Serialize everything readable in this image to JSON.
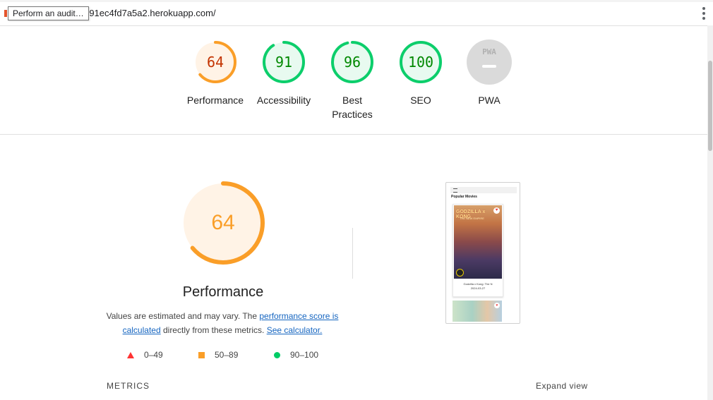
{
  "browser": {
    "url": "-91ec4fd7a5a2.herokuapp.com/",
    "tooltip": "Perform an audit…"
  },
  "categories": [
    {
      "label": "Performance",
      "score": "64",
      "value": 64,
      "color": "#fa9e28",
      "text_color": "#c33300",
      "bg": "#fff3e6"
    },
    {
      "label": "Accessibility",
      "score": "91",
      "value": 91,
      "color": "#0cce6b",
      "text_color": "#008800",
      "bg": "#e8faf0"
    },
    {
      "label": "Best Practices",
      "score": "96",
      "value": 96,
      "color": "#0cce6b",
      "text_color": "#008800",
      "bg": "#e8faf0"
    },
    {
      "label": "SEO",
      "score": "100",
      "value": 100,
      "color": "#0cce6b",
      "text_color": "#008800",
      "bg": "#e8faf0"
    },
    {
      "label": "PWA",
      "score": "PWA",
      "value": 0,
      "color": "#dadada",
      "text_color": "#b0b0b0",
      "bg": "#dadada"
    }
  ],
  "performance": {
    "score": "64",
    "value": 64,
    "title": "Performance",
    "desc_prefix": "Values are estimated and may vary. The ",
    "link_score": "performance score is calculated",
    "desc_middle": " directly from these metrics. ",
    "link_calc": "See calculator.",
    "legend": [
      {
        "range": "0–49",
        "icon": "fail-triangle-icon"
      },
      {
        "range": "50–89",
        "icon": "average-square-icon"
      },
      {
        "range": "90–100",
        "icon": "pass-circle-icon"
      }
    ]
  },
  "screenshot": {
    "heading": "Popular Movies",
    "poster_title": "GODZILLA x KONG",
    "poster_subtitle": "THE NEW EMPIRE",
    "caption_title": "Godzilla x Kong: The N",
    "caption_date": "2024-03-27"
  },
  "metrics": {
    "label": "METRICS",
    "expand": "Expand view"
  }
}
